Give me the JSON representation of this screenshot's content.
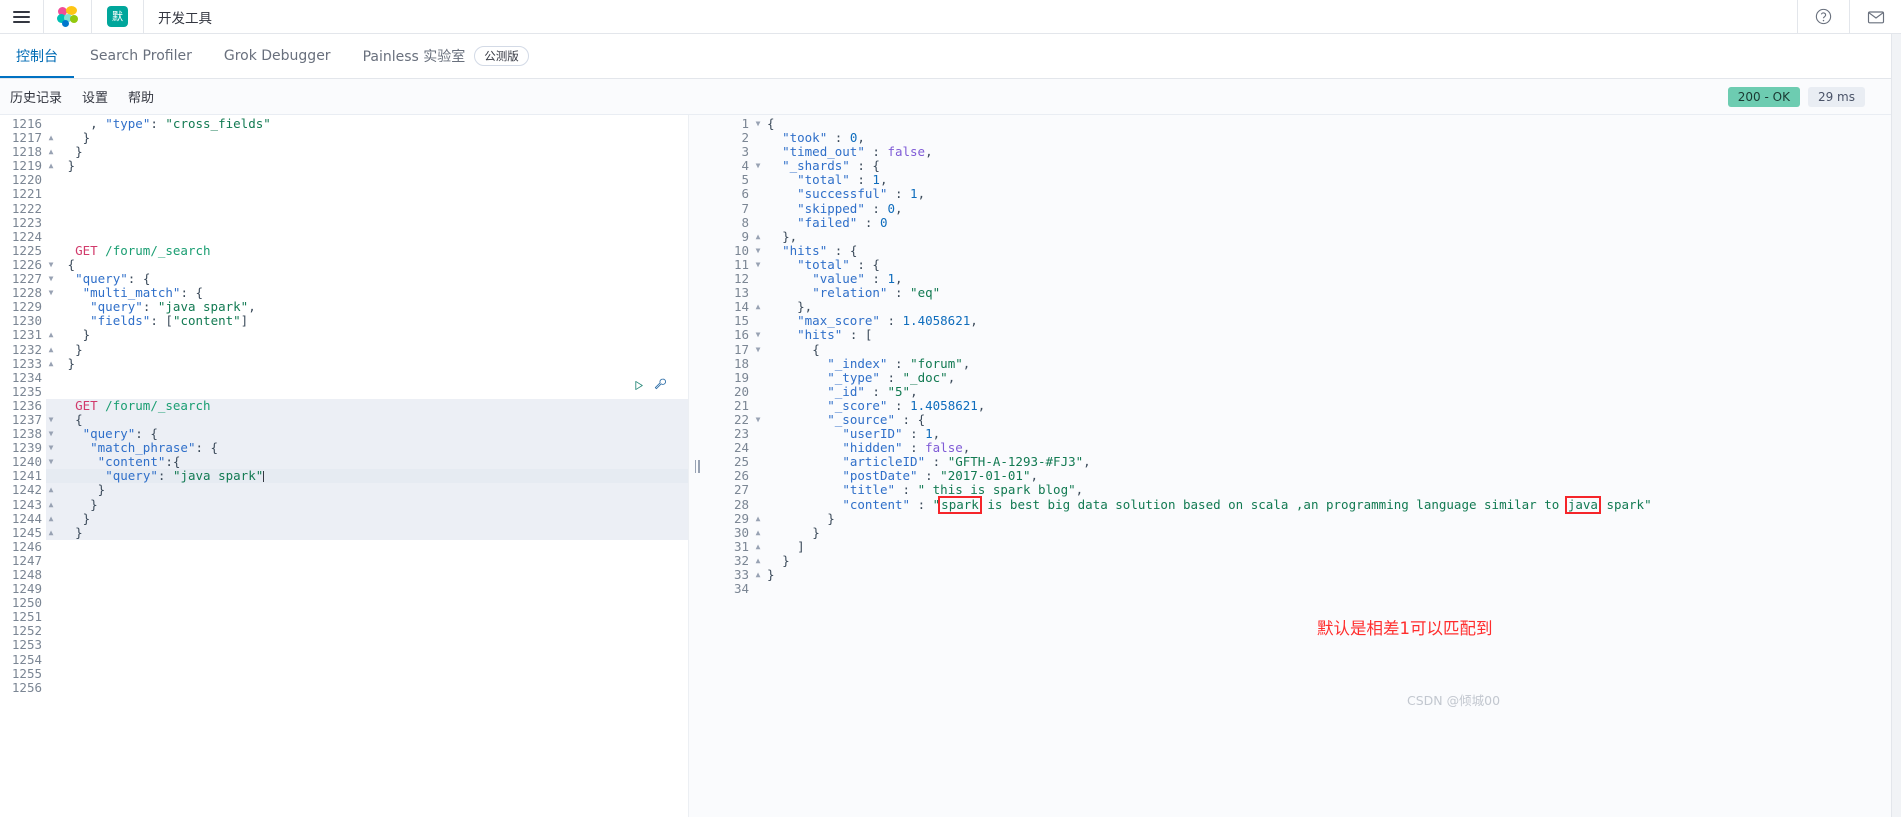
{
  "topbar": {
    "menu_label": "menu",
    "space_badge": "默",
    "app_title": "开发工具"
  },
  "apptabs": [
    {
      "label": "控制台",
      "active": true,
      "badge": null
    },
    {
      "label": "Search Profiler",
      "active": false,
      "badge": null
    },
    {
      "label": "Grok Debugger",
      "active": false,
      "badge": null
    },
    {
      "label": "Painless 实验室",
      "active": false,
      "badge": "公测版"
    }
  ],
  "consolebar": {
    "links": [
      "历史记录",
      "设置",
      "帮助"
    ],
    "status": "200 - OK",
    "time": "29 ms"
  },
  "editor": {
    "first_line_number": 1216,
    "active_line": 1241,
    "request_block_start": 1236,
    "request_block_end": 1245,
    "lines": [
      {
        "n": 1216,
        "fold": "",
        "text": "    , \"type\": \"cross_fields\""
      },
      {
        "n": 1217,
        "fold": "▲",
        "text": "   }"
      },
      {
        "n": 1218,
        "fold": "▲",
        "text": "  }"
      },
      {
        "n": 1219,
        "fold": "▲",
        "text": " }"
      },
      {
        "n": 1220,
        "fold": "",
        "text": ""
      },
      {
        "n": 1221,
        "fold": "",
        "text": ""
      },
      {
        "n": 1222,
        "fold": "",
        "text": ""
      },
      {
        "n": 1223,
        "fold": "",
        "text": ""
      },
      {
        "n": 1224,
        "fold": "",
        "text": ""
      },
      {
        "n": 1225,
        "fold": "",
        "text": "  GET /forum/_search"
      },
      {
        "n": 1226,
        "fold": "▼",
        "text": " {"
      },
      {
        "n": 1227,
        "fold": "▼",
        "text": "  \"query\": {"
      },
      {
        "n": 1228,
        "fold": "▼",
        "text": "   \"multi_match\": {"
      },
      {
        "n": 1229,
        "fold": "",
        "text": "    \"query\": \"java spark\","
      },
      {
        "n": 1230,
        "fold": "",
        "text": "    \"fields\": [\"content\"]"
      },
      {
        "n": 1231,
        "fold": "▲",
        "text": "   }"
      },
      {
        "n": 1232,
        "fold": "▲",
        "text": "  }"
      },
      {
        "n": 1233,
        "fold": "▲",
        "text": " }"
      },
      {
        "n": 1234,
        "fold": "",
        "text": ""
      },
      {
        "n": 1235,
        "fold": "",
        "text": ""
      },
      {
        "n": 1236,
        "fold": "",
        "text": "  GET /forum/_search"
      },
      {
        "n": 1237,
        "fold": "▼",
        "text": "  {"
      },
      {
        "n": 1238,
        "fold": "▼",
        "text": "   \"query\": {"
      },
      {
        "n": 1239,
        "fold": "▼",
        "text": "    \"match_phrase\": {"
      },
      {
        "n": 1240,
        "fold": "▼",
        "text": "     \"content\":{"
      },
      {
        "n": 1241,
        "fold": "",
        "text": "      \"query\": \"java spark\""
      },
      {
        "n": 1242,
        "fold": "▲",
        "text": "     }"
      },
      {
        "n": 1243,
        "fold": "▲",
        "text": "    }"
      },
      {
        "n": 1244,
        "fold": "▲",
        "text": "   }"
      },
      {
        "n": 1245,
        "fold": "▲",
        "text": "  }"
      },
      {
        "n": 1246,
        "fold": "",
        "text": ""
      },
      {
        "n": 1247,
        "fold": "",
        "text": ""
      },
      {
        "n": 1248,
        "fold": "",
        "text": ""
      },
      {
        "n": 1249,
        "fold": "",
        "text": ""
      },
      {
        "n": 1250,
        "fold": "",
        "text": ""
      },
      {
        "n": 1251,
        "fold": "",
        "text": ""
      },
      {
        "n": 1252,
        "fold": "",
        "text": ""
      },
      {
        "n": 1253,
        "fold": "",
        "text": ""
      },
      {
        "n": 1254,
        "fold": "",
        "text": ""
      },
      {
        "n": 1255,
        "fold": "",
        "text": ""
      },
      {
        "n": 1256,
        "fold": "",
        "text": ""
      }
    ]
  },
  "response": {
    "lines": [
      {
        "n": 1,
        "fold": "▼",
        "text": "{"
      },
      {
        "n": 2,
        "fold": "",
        "text": "  \"took\" : 0,"
      },
      {
        "n": 3,
        "fold": "",
        "text": "  \"timed_out\" : false,"
      },
      {
        "n": 4,
        "fold": "▼",
        "text": "  \"_shards\" : {"
      },
      {
        "n": 5,
        "fold": "",
        "text": "    \"total\" : 1,"
      },
      {
        "n": 6,
        "fold": "",
        "text": "    \"successful\" : 1,"
      },
      {
        "n": 7,
        "fold": "",
        "text": "    \"skipped\" : 0,"
      },
      {
        "n": 8,
        "fold": "",
        "text": "    \"failed\" : 0"
      },
      {
        "n": 9,
        "fold": "▲",
        "text": "  },"
      },
      {
        "n": 10,
        "fold": "▼",
        "text": "  \"hits\" : {"
      },
      {
        "n": 11,
        "fold": "▼",
        "text": "    \"total\" : {"
      },
      {
        "n": 12,
        "fold": "",
        "text": "      \"value\" : 1,"
      },
      {
        "n": 13,
        "fold": "",
        "text": "      \"relation\" : \"eq\""
      },
      {
        "n": 14,
        "fold": "▲",
        "text": "    },"
      },
      {
        "n": 15,
        "fold": "",
        "text": "    \"max_score\" : 1.4058621,"
      },
      {
        "n": 16,
        "fold": "▼",
        "text": "    \"hits\" : ["
      },
      {
        "n": 17,
        "fold": "▼",
        "text": "      {"
      },
      {
        "n": 18,
        "fold": "",
        "text": "        \"_index\" : \"forum\","
      },
      {
        "n": 19,
        "fold": "",
        "text": "        \"_type\" : \"_doc\","
      },
      {
        "n": 20,
        "fold": "",
        "text": "        \"_id\" : \"5\","
      },
      {
        "n": 21,
        "fold": "",
        "text": "        \"_score\" : 1.4058621,"
      },
      {
        "n": 22,
        "fold": "▼",
        "text": "        \"_source\" : {"
      },
      {
        "n": 23,
        "fold": "",
        "text": "          \"userID\" : 1,"
      },
      {
        "n": 24,
        "fold": "",
        "text": "          \"hidden\" : false,"
      },
      {
        "n": 25,
        "fold": "",
        "text": "          \"articleID\" : \"GFTH-A-1293-#FJ3\","
      },
      {
        "n": 26,
        "fold": "",
        "text": "          \"postDate\" : \"2017-01-01\","
      },
      {
        "n": 27,
        "fold": "",
        "text": "          \"title\" : \" this is spark blog\","
      },
      {
        "n": 28,
        "fold": "",
        "text": "          \"content\" : \"spark is best big data solution based on scala ,an programming language similar to java spark\""
      },
      {
        "n": 29,
        "fold": "▲",
        "text": "        }"
      },
      {
        "n": 30,
        "fold": "▲",
        "text": "      }"
      },
      {
        "n": 31,
        "fold": "▲",
        "text": "    ]"
      },
      {
        "n": 32,
        "fold": "▲",
        "text": "  }"
      },
      {
        "n": 33,
        "fold": "▲",
        "text": "}"
      },
      {
        "n": 34,
        "fold": "",
        "text": ""
      }
    ],
    "highlight_words": [
      "java",
      "spark"
    ]
  },
  "annotation": {
    "text": "默认是相差1可以匹配到",
    "color": "#ff2d2d"
  },
  "watermark": {
    "text": "CSDN @倾城00"
  }
}
